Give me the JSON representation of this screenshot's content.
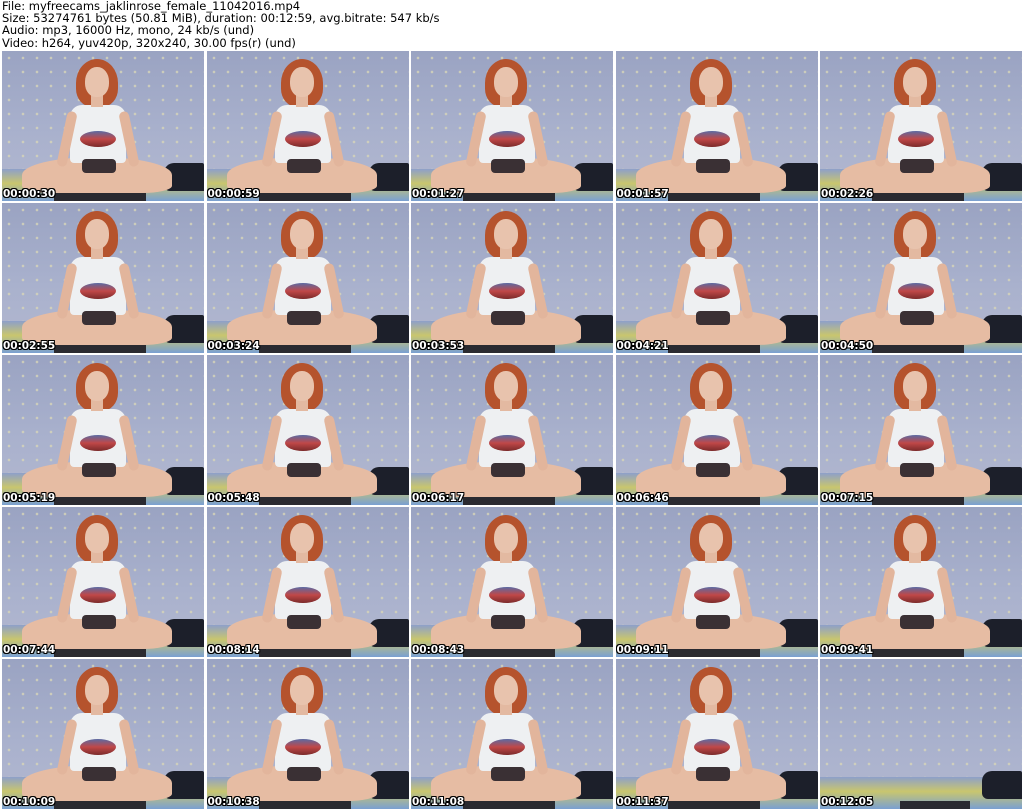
{
  "header": {
    "file": "File: myfreecams_jaklinrose_female_11042016.mp4",
    "size": "Size: 53274761 bytes (50.81 MiB), duration: 00:12:59, avg.bitrate: 547 kb/s",
    "audio": "Audio: mp3, 16000 Hz, mono, 24 kb/s (und)",
    "video": "Video: h264, yuv420p, 320x240, 30.00 fps(r) (und)"
  },
  "thumbnails": [
    {
      "timestamp": "00:00:30"
    },
    {
      "timestamp": "00:00:59"
    },
    {
      "timestamp": "00:01:27"
    },
    {
      "timestamp": "00:01:57"
    },
    {
      "timestamp": "00:02:26"
    },
    {
      "timestamp": "00:02:55"
    },
    {
      "timestamp": "00:03:24"
    },
    {
      "timestamp": "00:03:53"
    },
    {
      "timestamp": "00:04:21"
    },
    {
      "timestamp": "00:04:50"
    },
    {
      "timestamp": "00:05:19"
    },
    {
      "timestamp": "00:05:48"
    },
    {
      "timestamp": "00:06:17"
    },
    {
      "timestamp": "00:06:46"
    },
    {
      "timestamp": "00:07:15"
    },
    {
      "timestamp": "00:07:44"
    },
    {
      "timestamp": "00:08:14"
    },
    {
      "timestamp": "00:08:43"
    },
    {
      "timestamp": "00:09:11"
    },
    {
      "timestamp": "00:09:41"
    },
    {
      "timestamp": "00:10:09"
    },
    {
      "timestamp": "00:10:38"
    },
    {
      "timestamp": "00:11:08"
    },
    {
      "timestamp": "00:11:37"
    },
    {
      "timestamp": "00:12:05"
    }
  ]
}
